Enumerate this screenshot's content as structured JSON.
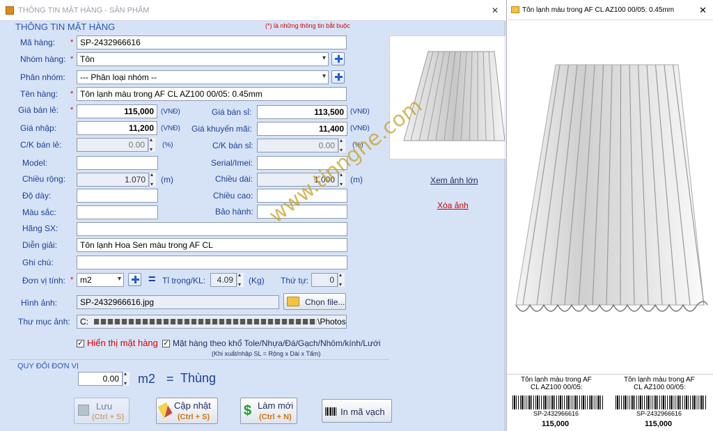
{
  "window": {
    "title": "THÔNG TIN MẶT HÀNG - SẢN PHẨM",
    "close": "✕",
    "section_title": "THÔNG TIN MẶT HÀNG",
    "required_note": "(*) là những thông tin bắt buộc"
  },
  "form": {
    "ma_hang": {
      "label": "Mã hàng:",
      "value": "SP-2432966616"
    },
    "nhom_hang": {
      "label": "Nhóm hàng:",
      "value": "Tôn"
    },
    "phan_nhom": {
      "label": "Phân nhóm:",
      "value": "--- Phân loại nhóm --"
    },
    "ten_hang": {
      "label": "Tên hàng:",
      "value": "Tôn lạnh màu trong AF CL AZ100 00/05: 0.45mm"
    },
    "gia_ban_le": {
      "label": "Giá bán lẻ:",
      "value": "115,000",
      "unit": "(VNĐ)"
    },
    "gia_ban_si": {
      "label": "Giá bán sỉ:",
      "value": "113,500",
      "unit": "(VNĐ)"
    },
    "gia_nhap": {
      "label": "Giá nhập:",
      "value": "11,200",
      "unit": "(VNĐ)"
    },
    "gia_khuyen_mai": {
      "label": "Giá khuyến mãi:",
      "value": "11,400",
      "unit": "(VNĐ)"
    },
    "ck_ban_le": {
      "label": "C/K bán lẻ:",
      "value": "0.00",
      "unit": "(%)"
    },
    "ck_ban_si": {
      "label": "C/K bán sỉ:",
      "value": "0.00",
      "unit": "(%)"
    },
    "model": {
      "label": "Model:",
      "value": ""
    },
    "serial": {
      "label": "Serial/Imei:",
      "value": ""
    },
    "chieu_rong": {
      "label": "Chiều rộng:",
      "value": "1.070",
      "unit": "(m)"
    },
    "chieu_dai": {
      "label": "Chiều dài:",
      "value": "1.000",
      "unit": "(m)"
    },
    "do_day": {
      "label": "Độ dày:",
      "value": ""
    },
    "chieu_cao": {
      "label": "Chiều cao:",
      "value": ""
    },
    "mau_sac": {
      "label": "Màu sắc:",
      "value": ""
    },
    "bao_hanh": {
      "label": "Bảo hành:",
      "value": ""
    },
    "hang_sx": {
      "label": "Hãng SX:",
      "value": ""
    },
    "dien_giai": {
      "label": "Diễn giải:",
      "value": "Tôn lạnh Hoa Sen màu trong AF CL"
    },
    "ghi_chu": {
      "label": "Ghi chú:",
      "value": ""
    },
    "don_vi_tinh": {
      "label": "Đơn vị tính:",
      "value": "m2"
    },
    "ti_trong": {
      "label": "Tỉ trọng/KL:",
      "value": "4.09",
      "unit": "(Kg)",
      "equals": "="
    },
    "thu_tu": {
      "label": "Thứ tự:",
      "value": "0"
    },
    "hinh_anh": {
      "label": "Hình ảnh:",
      "value": "SP-2432966616.jpg",
      "button": "Chọn file..."
    },
    "thu_muc_anh": {
      "label": "Thư mục ảnh:",
      "value_start": "C:",
      "value_end": "\\Photos"
    },
    "hien_thi": {
      "label": "Hiển thị mặt hàng",
      "checked": true
    },
    "theo_kho": {
      "label": "Mặt hàng theo khổ Tole/Nhựa/Đá/Gạch/Nhôm/kính/Lưới",
      "checked": true,
      "note": "(Khi xuất/nhập SL = Rộng x Dài x Tấm)"
    }
  },
  "quy_doi": {
    "title": "QUY ĐỔI ĐƠN VỊ",
    "value": "0.00",
    "unit_from": "m2",
    "equals": "=",
    "unit_to": "Thùng"
  },
  "buttons": {
    "luu": {
      "label": "Lưu",
      "shortcut": "(Ctrl + S)"
    },
    "cap_nhat": {
      "label": "Cập nhật",
      "shortcut": "(Ctrl + S)"
    },
    "lam_moi": {
      "label": "Làm mới",
      "shortcut": "(Ctrl + N)"
    },
    "in_ma_vach": {
      "label": "In mã vạch"
    }
  },
  "image_links": {
    "view_large": "Xem ảnh lớn",
    "delete": "Xóa ảnh"
  },
  "watermark": "www.tinnghe.com",
  "preview": {
    "title": "Tôn lạnh màu trong AF CL AZ100 00/05: 0.45mm",
    "close": "✕",
    "labels": [
      {
        "name_1": "Tôn lạnh màu trong AF",
        "name_2": "CL AZ100 00/05:",
        "code": "SP-2432966616",
        "price": "115,000"
      },
      {
        "name_1": "Tôn lạnh màu trong AF",
        "name_2": "CL AZ100 00/05:",
        "code": "SP-2432966616",
        "price": "115,000"
      }
    ]
  },
  "colors": {
    "label": "#1c3f95",
    "required": "#d00000",
    "shortcut": "#d4750c",
    "window_bg": "#d6e3f7",
    "watermark": "#c9a227"
  }
}
